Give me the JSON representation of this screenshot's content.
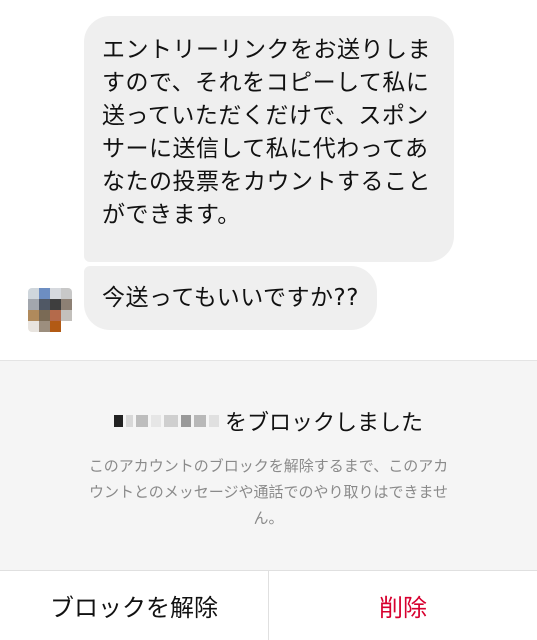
{
  "messages": [
    {
      "lines": [
        "エントリーリンクをお送りしま",
        "すので、それをコピーして私に",
        "送っていただくだけで、スポン",
        "サーに送信して私に代わってあ",
        "なたの投票をカウントすること",
        "ができます。"
      ]
    },
    {
      "lines": [
        "今送ってもいいですか??"
      ]
    }
  ],
  "avatar": {
    "colors": [
      "#cfd6dc",
      "#6d8ec2",
      "#d6d9de",
      "#c8c8c8",
      "#a2a6ad",
      "#505865",
      "#3e3e3e",
      "#8d8074",
      "#b08a5c",
      "#7a6a55",
      "#b46a4b",
      "#c3c0bc",
      "#e8e4df",
      "#9c8e7e",
      "#b25a14",
      "#ffffff"
    ]
  },
  "block_notice": {
    "title_suffix": "をブロックしました",
    "description_lines": [
      "このアカウントのブロックを解除するまで、このアカ",
      "ウントとのメッセージや通話でのやり取りはできませ",
      "ん。"
    ]
  },
  "actions": {
    "unblock_label": "ブロックを解除",
    "delete_label": "削除"
  },
  "colors": {
    "bubble": "#efefef",
    "delete_red": "#d7002f",
    "muted_text": "#8a8a8a"
  }
}
